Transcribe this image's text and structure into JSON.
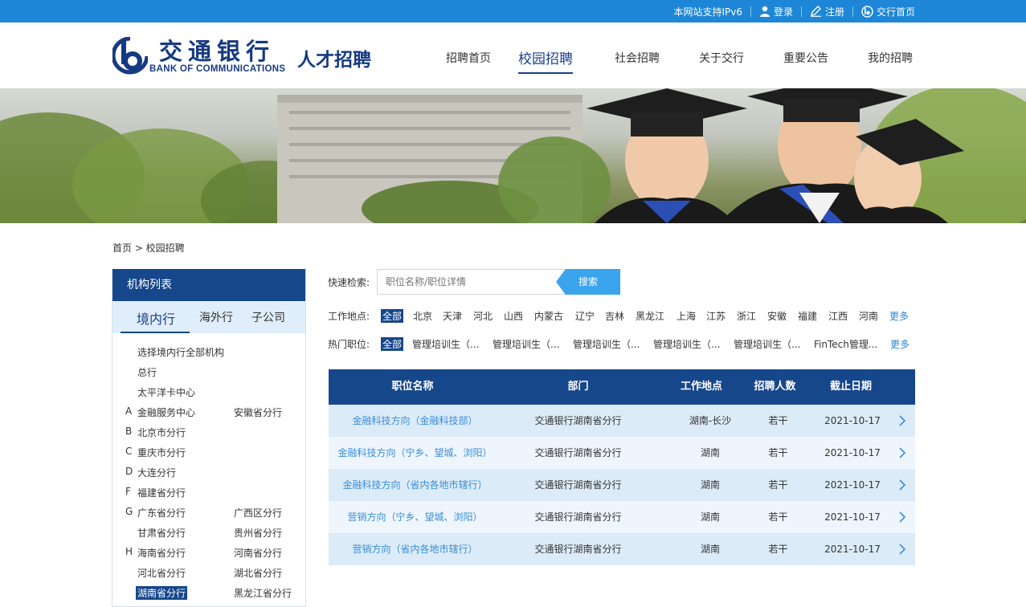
{
  "topbar": {
    "ipv6": "本网站支持IPv6",
    "login": "登录",
    "register": "注册",
    "home": "交行首页"
  },
  "logo": {
    "cn": "交通银行",
    "en": "BANK OF COMMUNICATIONS",
    "slogan": "人才招聘"
  },
  "nav": [
    "招聘首页",
    "校园招聘",
    "社会招聘",
    "关于交行",
    "重要公告",
    "我的招聘"
  ],
  "breadcrumb": "首页 > 校园招聘",
  "sidebar": {
    "title": "机构列表",
    "tabs": [
      "境内行",
      "海外行",
      "子公司"
    ],
    "items": [
      "选择境内行全部机构",
      "总行",
      "太平洋卡中心",
      "金融服务中心",
      "安徽省分行",
      "北京市分行",
      "重庆市分行",
      "大连分行",
      "福建省分行",
      "广东省分行",
      "广西区分行",
      "甘肃省分行",
      "贵州省分行",
      "海南省分行",
      "河南省分行",
      "河北省分行",
      "湖北省分行",
      "湖南省分行",
      "黑龙江省分行"
    ],
    "letters": [
      "A",
      "B",
      "C",
      "D",
      "F",
      "G",
      "H"
    ]
  },
  "search": {
    "label": "快速检索:",
    "placeholder": "职位名称/职位详情",
    "button": "搜索"
  },
  "location_filter": {
    "label": "工作地点:",
    "items": [
      "全部",
      "北京",
      "天津",
      "河北",
      "山西",
      "内蒙古",
      "辽宁",
      "吉林",
      "黑龙江",
      "上海",
      "江苏",
      "浙江",
      "安徽",
      "福建",
      "江西",
      "河南"
    ],
    "more": "更多"
  },
  "job_filter": {
    "label": "热门职位:",
    "items": [
      "全部",
      "管理培训生（...",
      "管理培训生（...",
      "管理培训生（...",
      "管理培训生（...",
      "管理培训生（...",
      "FinTech管理..."
    ],
    "more": "更多"
  },
  "table": {
    "headers": [
      "职位名称",
      "部门",
      "工作地点",
      "招聘人数",
      "截止日期"
    ],
    "rows": [
      [
        "金融科技方向（金融科技部）",
        "交通银行湖南省分行",
        "湖南-长沙",
        "若干",
        "2021-10-17"
      ],
      [
        "金融科技方向（宁乡、望城、浏阳）",
        "交通银行湖南省分行",
        "湖南",
        "若干",
        "2021-10-17"
      ],
      [
        "金融科技方向（省内各地市辖行）",
        "交通银行湖南省分行",
        "湖南",
        "若干",
        "2021-10-17"
      ],
      [
        "营销方向（宁乡、望城、浏阳）",
        "交通银行湖南省分行",
        "湖南",
        "若干",
        "2021-10-17"
      ],
      [
        "营销方向（省内各地市辖行）",
        "交通银行湖南省分行",
        "湖南",
        "若干",
        "2021-10-17"
      ]
    ]
  },
  "colors": {
    "topbar": "#1e86d6",
    "brand": "#17478b",
    "link": "#3a8ed6",
    "search_button": "#3aa4ec"
  }
}
